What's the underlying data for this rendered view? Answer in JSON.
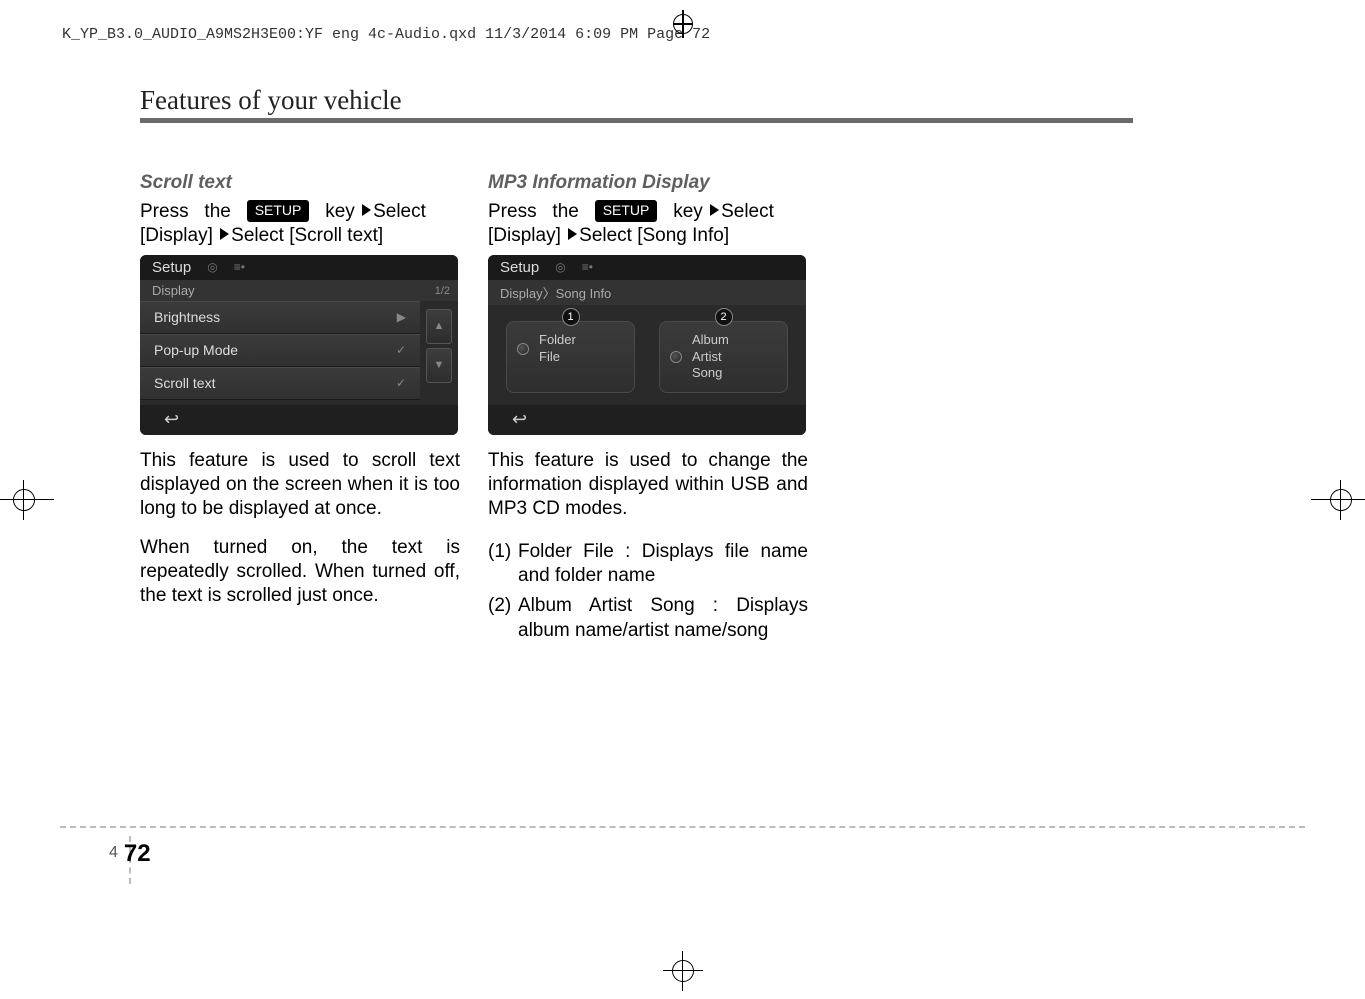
{
  "header_line": "K_YP_B3.0_AUDIO_A9MS2H3E00:YF eng 4c-Audio.qxd  11/3/2014  6:09 PM  Page 72",
  "chapter_title": "Features of your vehicle",
  "col1": {
    "subhead": "Scroll text",
    "press_word": "Press",
    "the_word": "the",
    "setup_label": "SETUP",
    "key_word": "key",
    "select_word": "Select",
    "step2": "[Display]",
    "select2": "Select [Scroll text]",
    "screen": {
      "title": "Setup",
      "crumb": "Display",
      "page": "1/2",
      "rows": [
        "Brightness",
        "Pop-up Mode",
        "Scroll text"
      ]
    },
    "p1": "This feature is used to scroll text displayed on the screen when it is too long to be displayed at once.",
    "p2": "When turned on, the text is repeatedly scrolled. When turned off, the text is scrolled just once."
  },
  "col2": {
    "subhead": "MP3 Information Display",
    "press_word": "Press",
    "the_word": "the",
    "setup_label": "SETUP",
    "key_word": "key",
    "select_word": "Select",
    "step2": "[Display]",
    "select2": "Select [Song Info]",
    "screen": {
      "title": "Setup",
      "crumb": "Display〉Song Info",
      "opt1_l1": "Folder",
      "opt1_l2": "File",
      "opt2_l1": "Album",
      "opt2_l2": "Artist",
      "opt2_l3": "Song"
    },
    "p1": "This feature is used to change the information displayed within USB and MP3 CD modes.",
    "list": [
      {
        "n": "(1)",
        "t": "Folder File : Displays file name and folder name"
      },
      {
        "n": "(2)",
        "t": "Album Artist Song : Displays album name/artist name/song"
      }
    ]
  },
  "folio": {
    "chapter": "4",
    "page": "72"
  }
}
